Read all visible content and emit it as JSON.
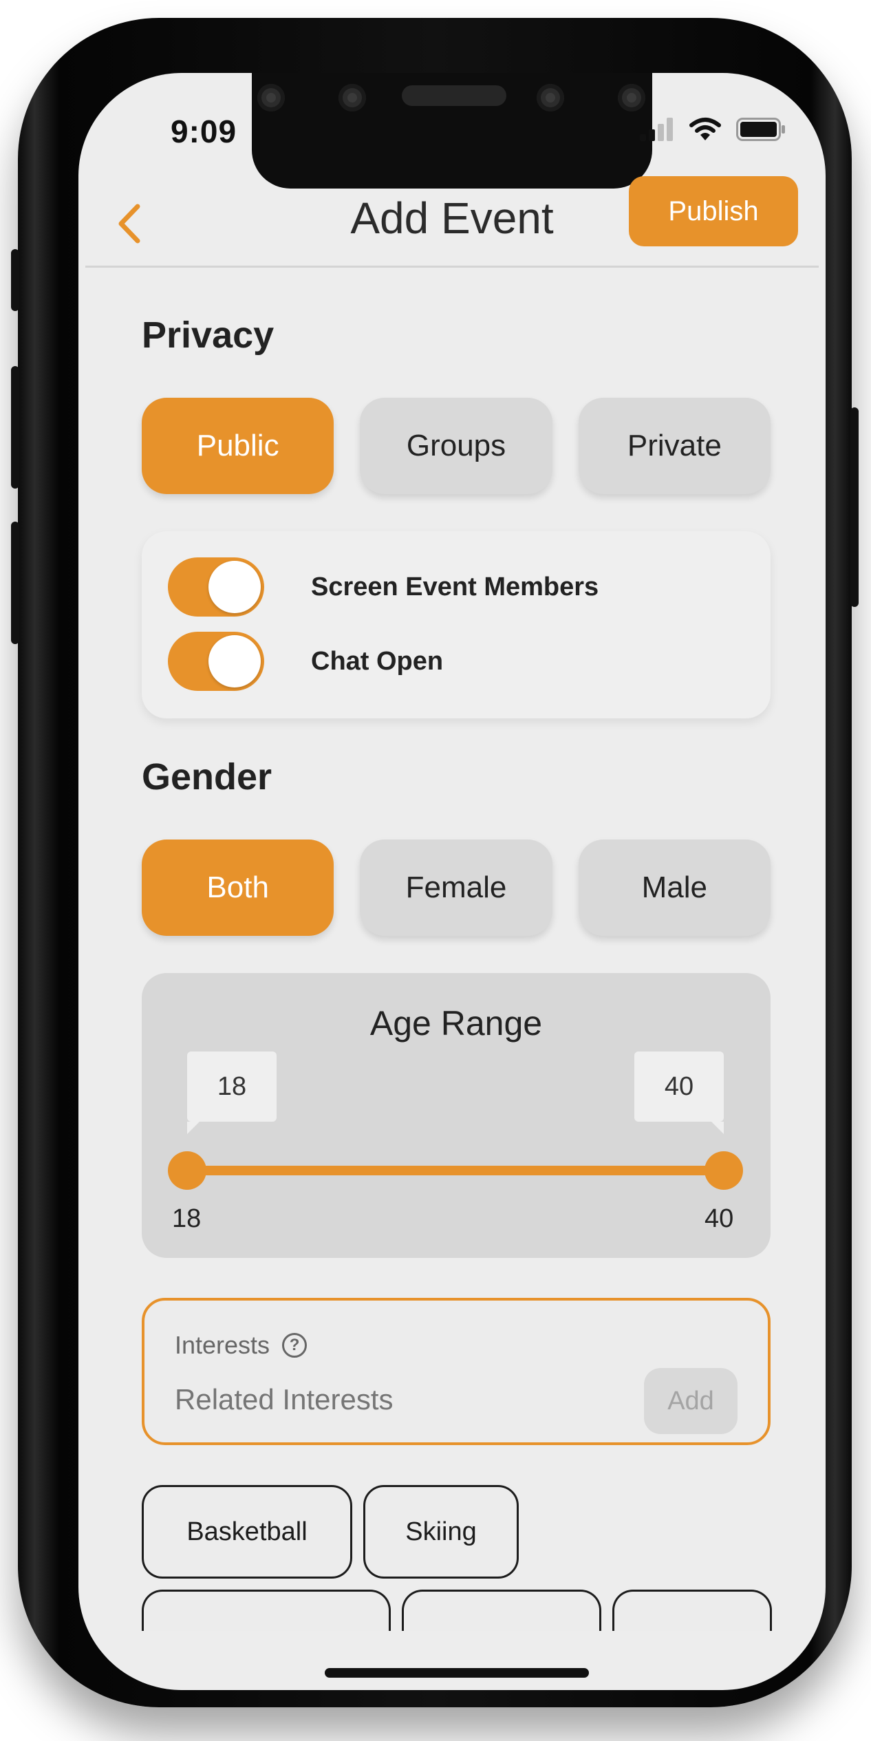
{
  "status_bar": {
    "time": "9:09"
  },
  "header": {
    "title": "Add Event",
    "publish_label": "Publish",
    "back_icon": "chevron-left-icon"
  },
  "privacy": {
    "title": "Privacy",
    "options": [
      "Public",
      "Groups",
      "Private"
    ],
    "selected": "Public",
    "toggles": [
      {
        "label": "Screen Event Members",
        "on": true
      },
      {
        "label": "Chat Open",
        "on": true
      }
    ]
  },
  "gender": {
    "title": "Gender",
    "options": [
      "Both",
      "Female",
      "Male"
    ],
    "selected": "Both"
  },
  "age_range": {
    "title": "Age Range",
    "min_value": "18",
    "max_value": "40",
    "min_label": "18",
    "max_label": "40"
  },
  "interests": {
    "label": "Interests",
    "placeholder": "Related Interests",
    "add_label": "Add",
    "chips": [
      "Basketball",
      "Skiing"
    ]
  },
  "colors": {
    "accent": "#e7922b",
    "background": "#ededed",
    "segment_inactive": "#d9d9d9"
  }
}
